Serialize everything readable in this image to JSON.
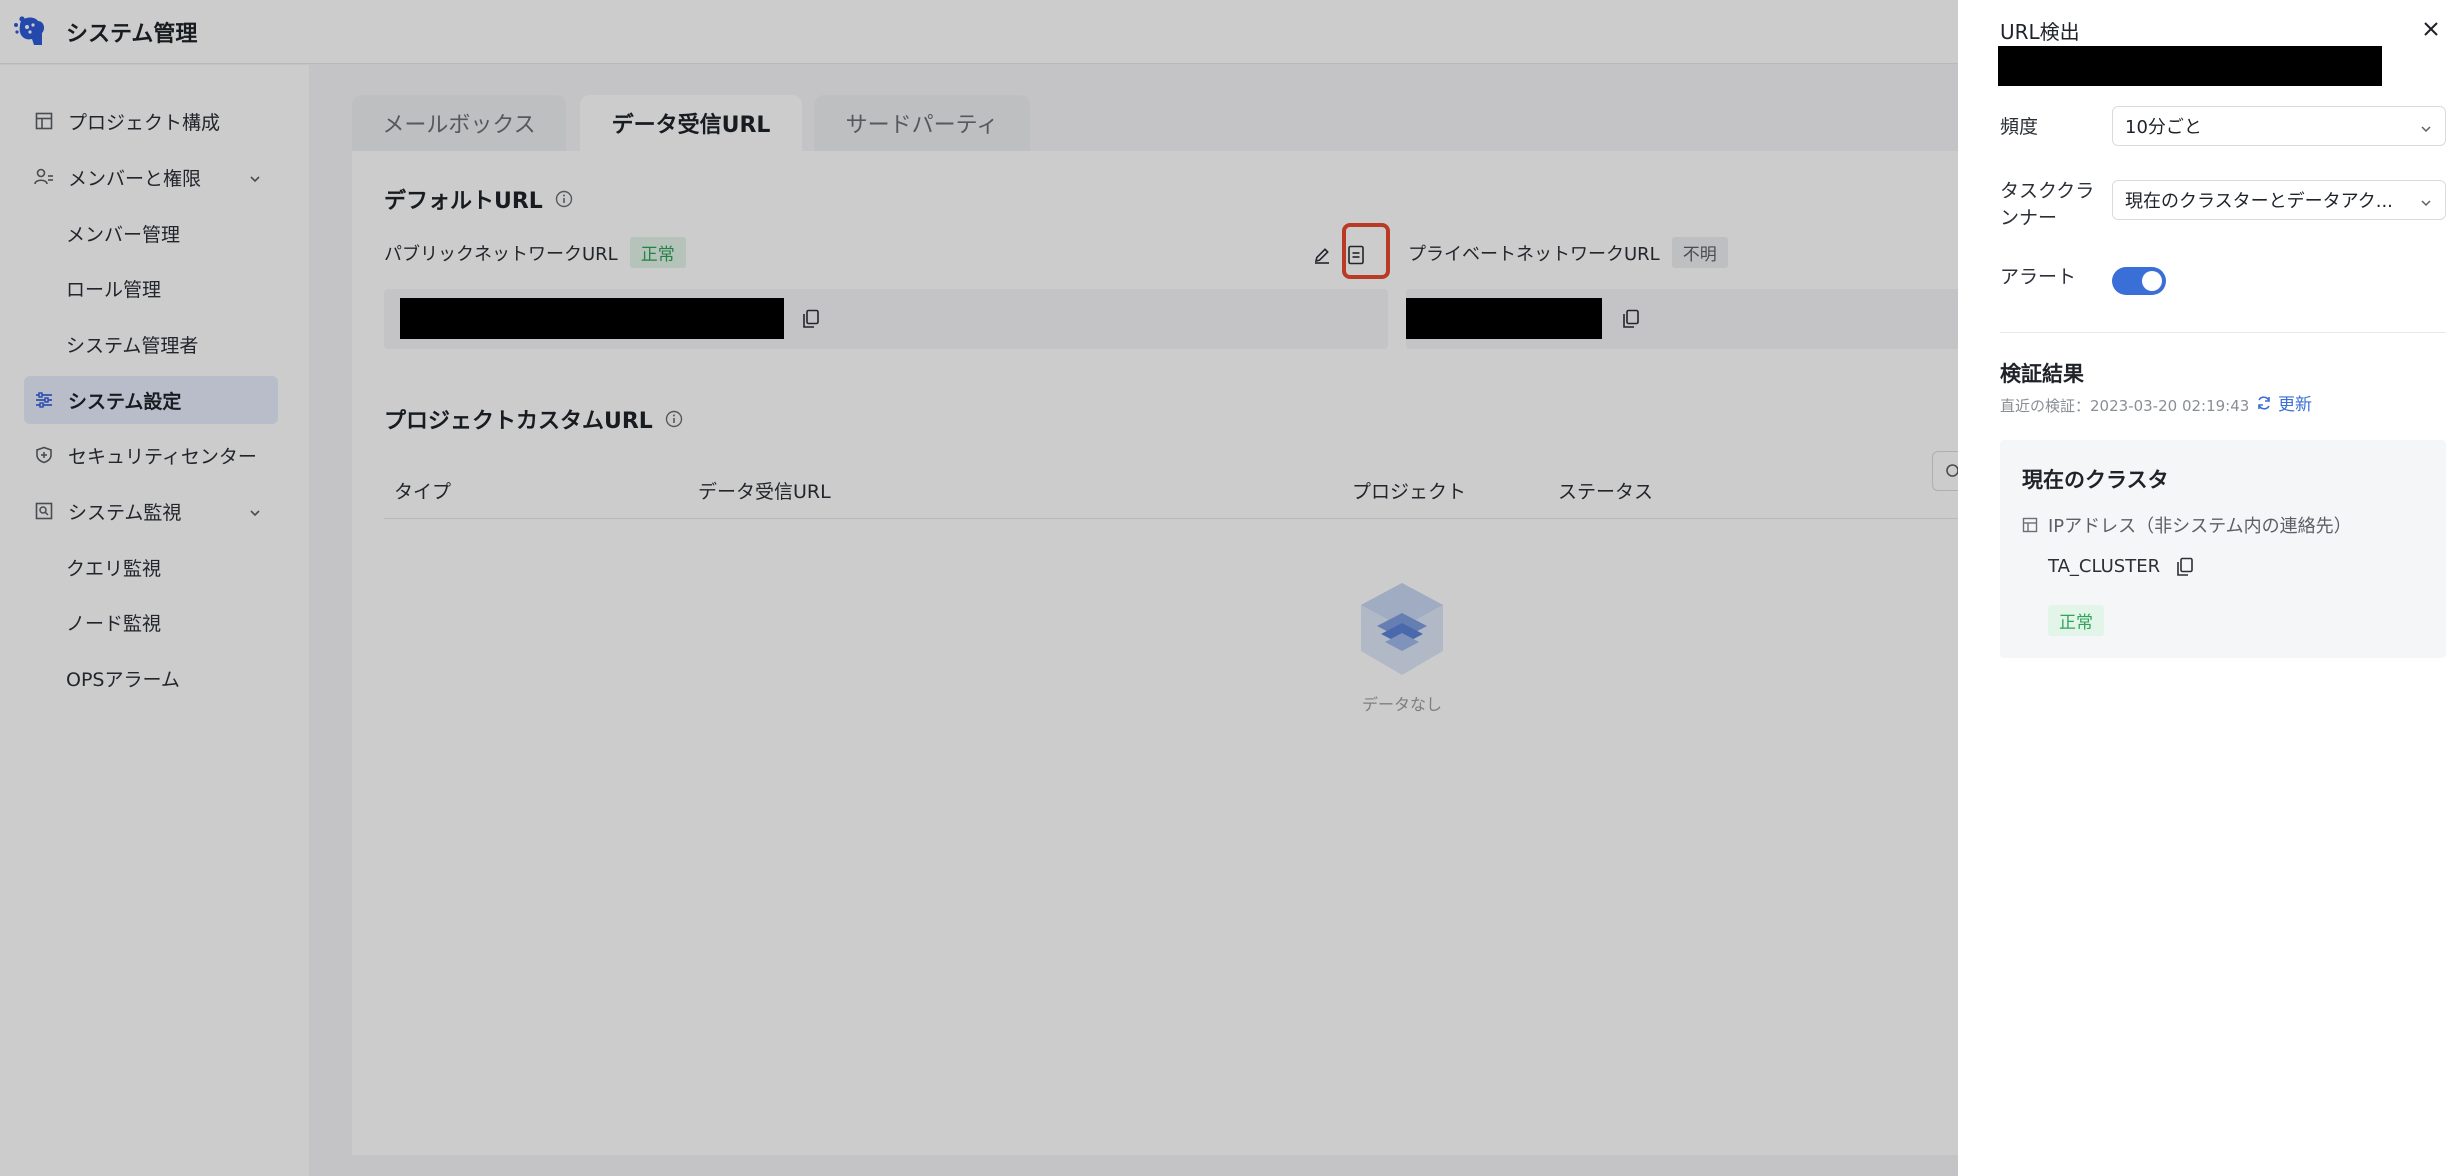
{
  "app": {
    "title": "システム管理"
  },
  "sidebar": {
    "items": [
      {
        "label": "プロジェクト構成",
        "icon": "layout-icon"
      },
      {
        "label": "メンバーと権限",
        "icon": "members-icon",
        "expanded": true
      },
      {
        "label": "メンバー管理"
      },
      {
        "label": "ロール管理"
      },
      {
        "label": "システム管理者"
      },
      {
        "label": "システム設定",
        "icon": "sliders-icon",
        "active": true
      },
      {
        "label": "セキュリティセンター",
        "icon": "shield-icon"
      },
      {
        "label": "システム監視",
        "icon": "monitor-icon",
        "expanded": true
      },
      {
        "label": "クエリ監視"
      },
      {
        "label": "ノード監視"
      },
      {
        "label": "OPSアラーム"
      }
    ]
  },
  "tabs": [
    {
      "label": "メールボックス",
      "active": false
    },
    {
      "label": "データ受信URL",
      "active": true
    },
    {
      "label": "サードパーティ",
      "active": false
    }
  ],
  "default_url": {
    "title": "デフォルトURL",
    "public_label": "パブリックネットワークURL",
    "public_status": "正常",
    "private_label": "プライベートネットワークURL",
    "private_status": "不明"
  },
  "custom_url": {
    "title": "プロジェクトカスタムURL",
    "columns": [
      "タイプ",
      "データ受信URL",
      "プロジェクト",
      "ステータス"
    ],
    "empty_text": "データなし"
  },
  "drawer": {
    "title": "URL検出",
    "frequency_label": "頻度",
    "frequency_value": "10分ごと",
    "runner_label_line1": "タスククラ",
    "runner_label_line2": "ンナー",
    "runner_value": "現在のクラスターとデータアク...",
    "alert_label": "アラート",
    "alert_on": true,
    "result_title": "検証結果",
    "last_check": "直近の検証：2023-03-20 02:19:43",
    "refresh_label": "更新",
    "cluster_title": "現在のクラスタ",
    "ip_label": "IPアドレス（非システム内の連絡先）",
    "cluster_name": "TA_CLUSTER",
    "cluster_status": "正常"
  },
  "colors": {
    "accent": "#3b6fd8",
    "ok": "#2ea35a",
    "highlight": "#e84a2f"
  }
}
